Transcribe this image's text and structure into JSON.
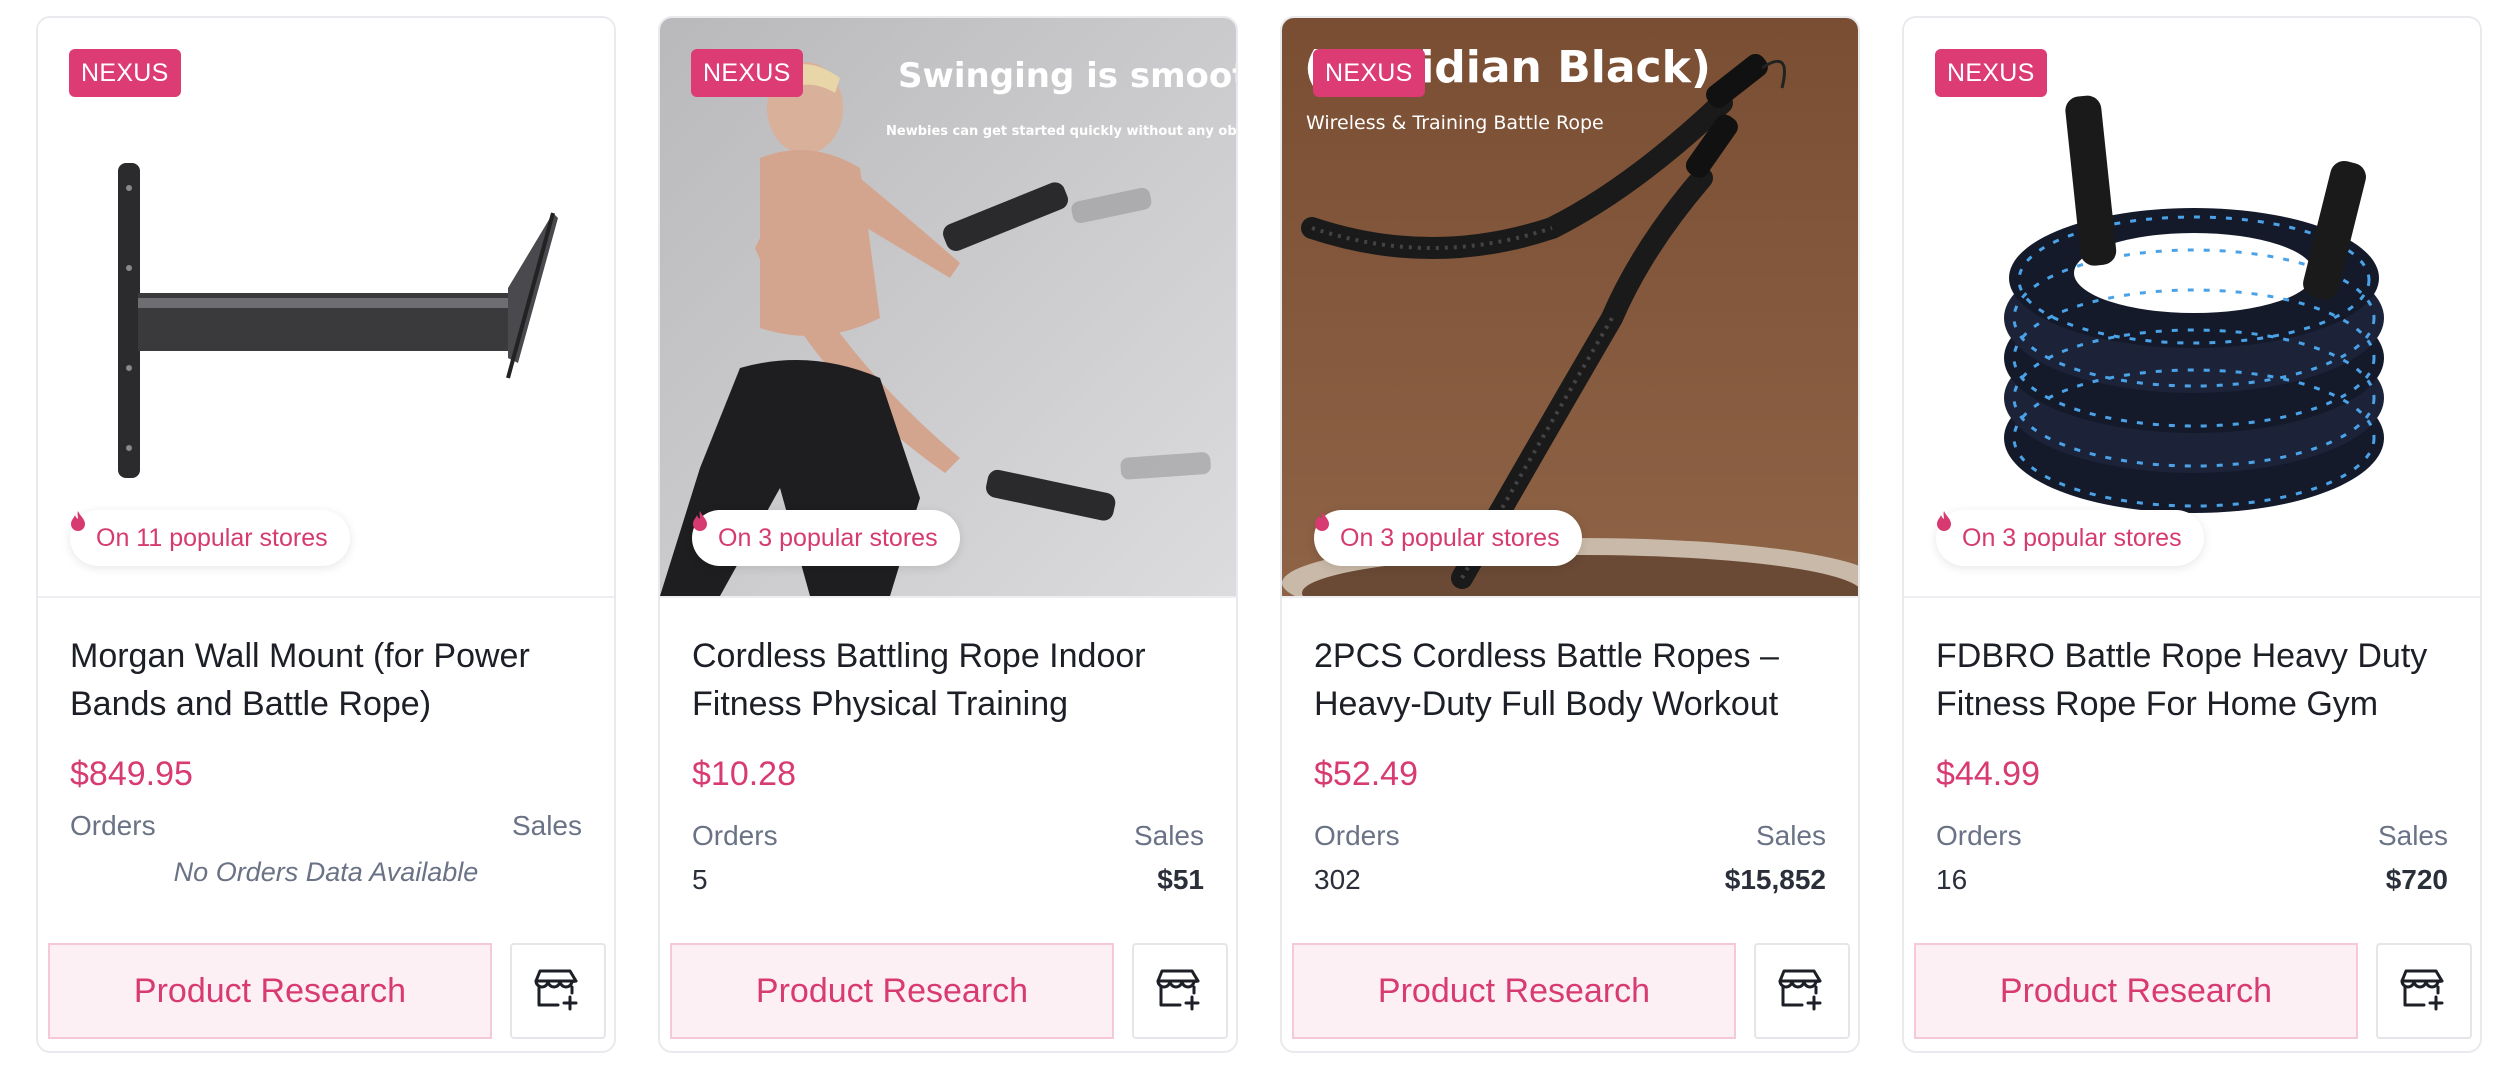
{
  "colors": {
    "accent": "#dc3b74",
    "price": "#d83a72",
    "research_bg": "#fdf0f4",
    "muted": "#6a7285"
  },
  "icons": {
    "popular": "flame-icon",
    "store": "add-store-icon"
  },
  "cards": [
    {
      "badge": "NEXUS",
      "popular": "On 11 popular stores",
      "image_overlay": {
        "headline": "",
        "subline": ""
      },
      "title": "Morgan Wall Mount (for Power Bands and Battle Rope)",
      "price": "$849.95",
      "orders_label": "Orders",
      "sales_label": "Sales",
      "no_data": "No Orders Data Available",
      "research_label": "Product Research"
    },
    {
      "badge": "NEXUS",
      "popular": "On 3 popular stores",
      "image_overlay": {
        "headline": "Swinging is smooth",
        "subline": "Newbies can get started quickly without any obstacles"
      },
      "title": "Cordless Battling Rope Indoor Fitness Physical Training Strength",
      "price": "$10.28",
      "orders_label": "Orders",
      "sales_label": "Sales",
      "orders": "5",
      "sales": "$51",
      "research_label": "Product Research"
    },
    {
      "badge": "NEXUS",
      "popular": "On 3 popular stores",
      "image_overlay": {
        "headline": "(Obsidian Black)",
        "subline": "Wireless & Training Battle Rope"
      },
      "title": "2PCS Cordless Battle Ropes – Heavy-Duty Full Body Workout",
      "price": "$52.49",
      "orders_label": "Orders",
      "sales_label": "Sales",
      "orders": "302",
      "sales": "$15,852",
      "research_label": "Product Research"
    },
    {
      "badge": "NEXUS",
      "popular": "On 3 popular stores",
      "image_overlay": {
        "headline": "",
        "subline": ""
      },
      "title": "FDBRO Battle Rope Heavy Duty Fitness Rope For Home Gym",
      "price": "$44.99",
      "orders_label": "Orders",
      "sales_label": "Sales",
      "orders": "16",
      "sales": "$720",
      "research_label": "Product Research"
    }
  ]
}
